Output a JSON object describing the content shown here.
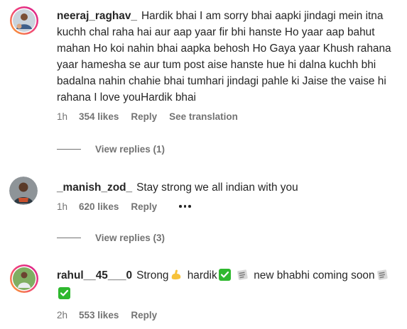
{
  "comments": [
    {
      "username": "neeraj_raghav_",
      "text": "Hardik bhai I am sorry bhai aapki jindagi mein itna kuchh chal raha hai aur aap yaar fir bhi hanste Ho yaar aap bahut mahan Ho koi nahin bhai aapka behosh Ho Gaya yaar Khush rahana yaar hamesha se aur tum post aise hanste hue hi dalna kuchh bhi badalna nahin chahie bhai tumhari jindagi pahle ki Jaise the vaise hi rahana I love youHardik bhai",
      "time": "1h",
      "likes": "354 likes",
      "reply": "Reply",
      "translation": "See translation",
      "view_replies": "View replies (1)"
    },
    {
      "username": "_manish_zod_",
      "text": "Stay strong we all indian with you",
      "time": "1h",
      "likes": "620 likes",
      "reply": "Reply",
      "view_replies": "View replies (3)"
    },
    {
      "username": "rahul__45___0",
      "text_part1": "Strong",
      "text_part2": "hardik",
      "text_part3": "new bhabhi coming soon",
      "time": "2h",
      "likes": "553 likes",
      "reply": "Reply"
    }
  ],
  "colors": {
    "text": "#262626",
    "muted": "#737373",
    "story_ring_start": "#f9a825",
    "story_ring_end": "#d81b8c",
    "check_green": "#2eb82e"
  }
}
